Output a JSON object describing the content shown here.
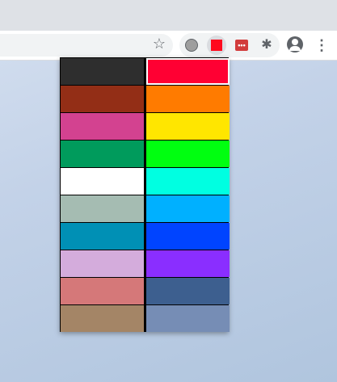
{
  "toolbar": {
    "bookmark_icon": "star-icon",
    "extensions": [
      {
        "name": "tomato-icon"
      },
      {
        "name": "color-picker-icon",
        "color": "#ff0a1e",
        "active": true
      },
      {
        "name": "extension-dots-icon",
        "label": "•••"
      },
      {
        "name": "puzzle-icon"
      }
    ],
    "account_icon": "account-icon",
    "menu_icon": "kebab-menu-icon"
  },
  "palette": {
    "selected": "#ff0033",
    "colors": [
      "#2e2e2e",
      "#ff0033",
      "#932e16",
      "#ff7b00",
      "#d34290",
      "#ffe600",
      "#009b5c",
      "#00ff10",
      "#ffffff",
      "#00ffe1",
      "#a5bcb2",
      "#00b0ff",
      "#0090b5",
      "#0044ff",
      "#d4acdc",
      "#8a2eff",
      "#d57879",
      "#3d5f8f",
      "#a48566",
      "#768db5"
    ]
  }
}
